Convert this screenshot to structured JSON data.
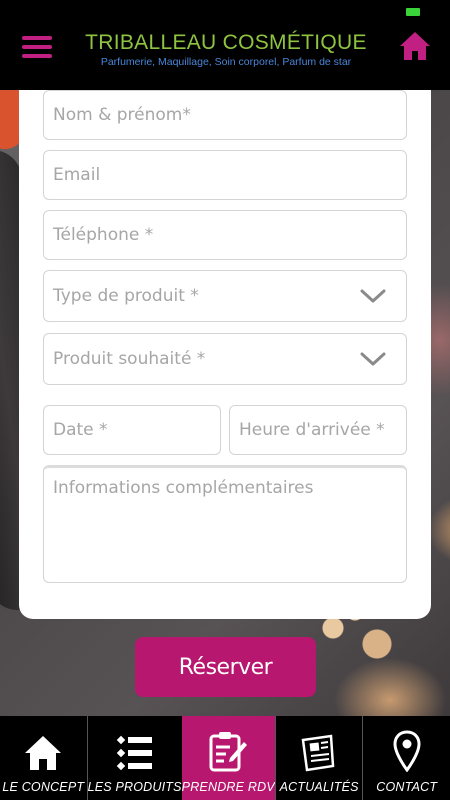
{
  "header": {
    "title": "TRIBALLEAU COSMÉTIQUE",
    "subtitle": "Parfumerie, Maquillage, Soin corporel, Parfum de star",
    "menu_icon": "hamburger-menu-icon",
    "home_icon": "home-icon"
  },
  "colors": {
    "accent": "#b8176f",
    "brand_green": "#8fc440",
    "subtitle_blue": "#4a86d8"
  },
  "form": {
    "name_placeholder": "Nom & prénom*",
    "email_placeholder": "Email",
    "phone_placeholder": "Téléphone *",
    "product_type_placeholder": "Type de produit *",
    "product_wanted_placeholder": "Produit souhaité *",
    "date_placeholder": "Date *",
    "arrival_time_placeholder": "Heure d'arrivée *",
    "info_placeholder": "Informations complémentaires",
    "submit_label": "Réserver"
  },
  "nav": {
    "items": [
      {
        "label": "LE CONCEPT",
        "icon": "home-icon",
        "active": false
      },
      {
        "label": "LES PRODUITS",
        "icon": "list-icon",
        "active": false
      },
      {
        "label": "PRENDRE RDV",
        "icon": "clipboard-edit-icon",
        "active": true
      },
      {
        "label": "ACTUALITÉS",
        "icon": "newspaper-icon",
        "active": false
      },
      {
        "label": "CONTACT",
        "icon": "location-pin-icon",
        "active": false
      }
    ]
  }
}
